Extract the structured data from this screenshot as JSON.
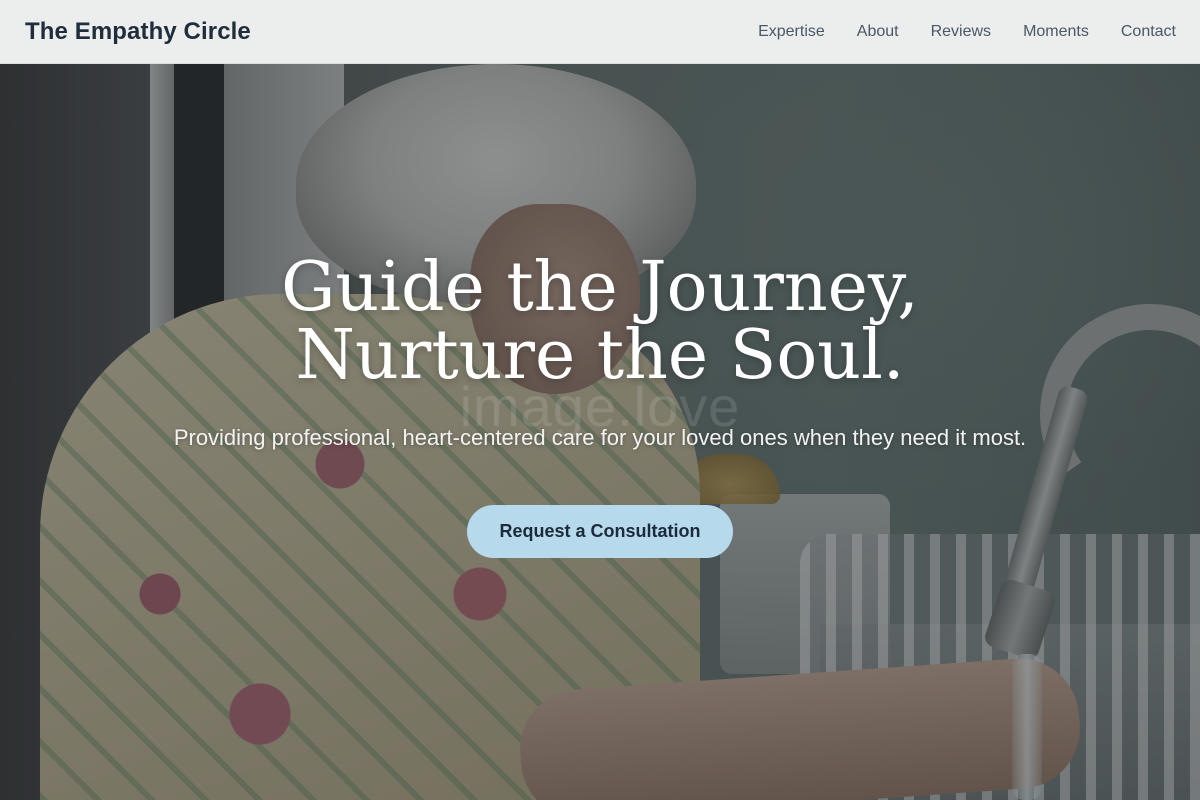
{
  "brand": {
    "name": "The Empathy Circle"
  },
  "nav": {
    "items": [
      {
        "label": "Expertise"
      },
      {
        "label": "About"
      },
      {
        "label": "Reviews"
      },
      {
        "label": "Moments"
      },
      {
        "label": "Contact"
      }
    ]
  },
  "hero": {
    "headline_line1": "Guide the Journey,",
    "headline_line2": "Nurture the Soul.",
    "subtitle": "Providing professional, heart-centered care for your loved ones when they need it most.",
    "cta_label": "Request a Consultation",
    "watermark": "image.love",
    "image_subject": "elderly woman washing hands at a kitchen sink"
  },
  "colors": {
    "brand_text": "#1f2d3d",
    "nav_text": "#4a5766",
    "header_bg": "#f6f7f7",
    "cta_bg": "#b7d9ec",
    "cta_text": "#1c2b3a",
    "hero_text": "#ffffff"
  }
}
